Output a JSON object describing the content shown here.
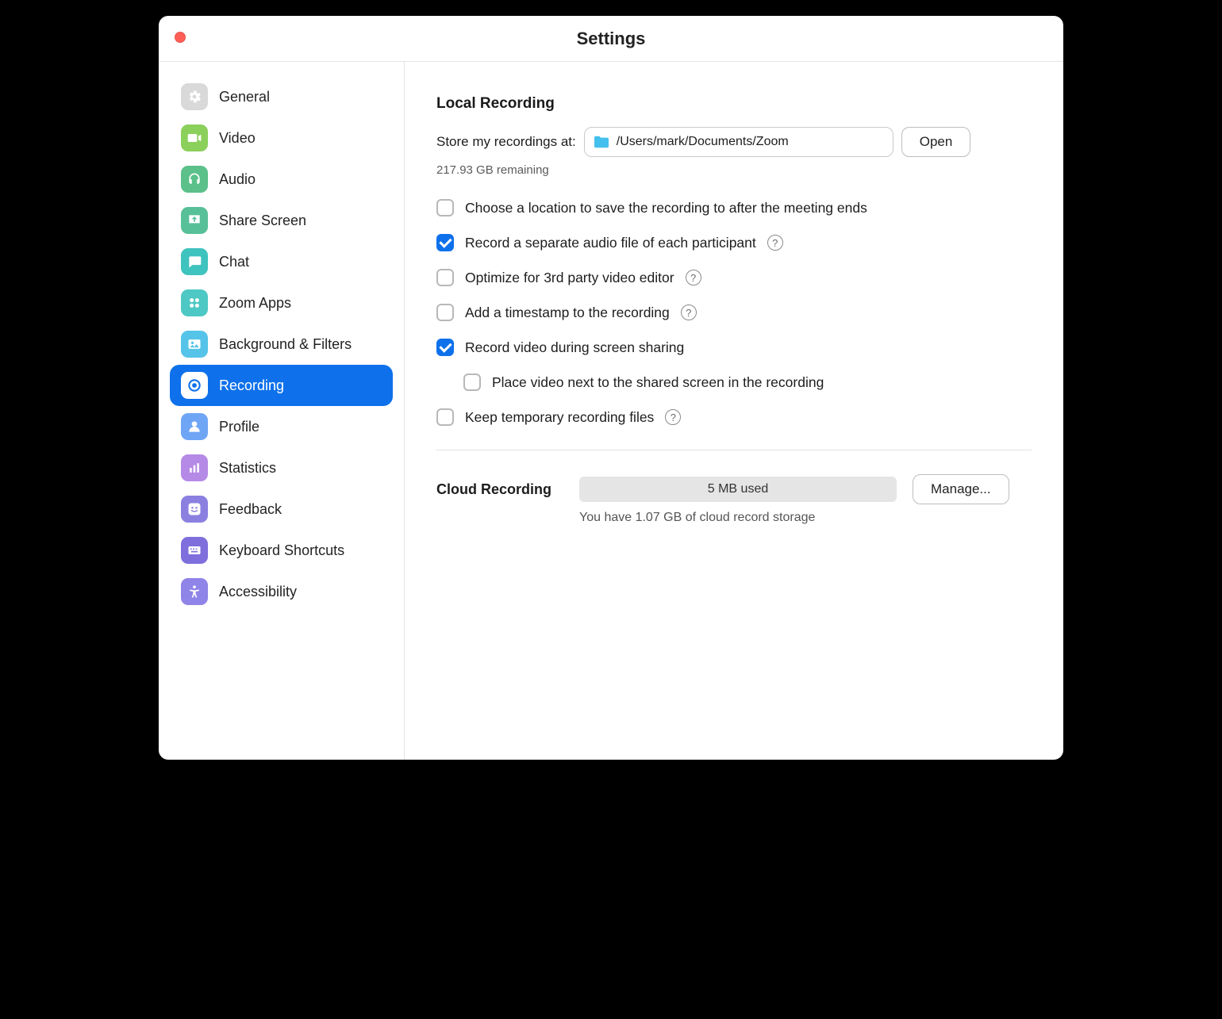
{
  "window": {
    "title": "Settings"
  },
  "sidebar": {
    "items": [
      {
        "label": "General"
      },
      {
        "label": "Video"
      },
      {
        "label": "Audio"
      },
      {
        "label": "Share Screen"
      },
      {
        "label": "Chat"
      },
      {
        "label": "Zoom Apps"
      },
      {
        "label": "Background & Filters"
      },
      {
        "label": "Recording"
      },
      {
        "label": "Profile"
      },
      {
        "label": "Statistics"
      },
      {
        "label": "Feedback"
      },
      {
        "label": "Keyboard Shortcuts"
      },
      {
        "label": "Accessibility"
      }
    ]
  },
  "content": {
    "local": {
      "heading": "Local Recording",
      "store_label": "Store my recordings at:",
      "path": "/Users/mark/Documents/Zoom",
      "open": "Open",
      "remaining": "217.93 GB remaining",
      "options": [
        {
          "label": "Choose a location to save the recording to after the meeting ends",
          "checked": false
        },
        {
          "label": "Record a separate audio file of each participant",
          "checked": true,
          "help": true
        },
        {
          "label": "Optimize for 3rd party video editor",
          "checked": false,
          "help": true
        },
        {
          "label": "Add a timestamp to the recording",
          "checked": false,
          "help": true
        },
        {
          "label": "Record video during screen sharing",
          "checked": true
        },
        {
          "label": "Place video next to the shared screen in the recording",
          "checked": false,
          "indent": true
        },
        {
          "label": "Keep temporary recording files",
          "checked": false,
          "help": true
        }
      ]
    },
    "cloud": {
      "heading": "Cloud Recording",
      "usage": "5 MB used",
      "manage": "Manage...",
      "note": "You have 1.07 GB of cloud record storage"
    }
  }
}
